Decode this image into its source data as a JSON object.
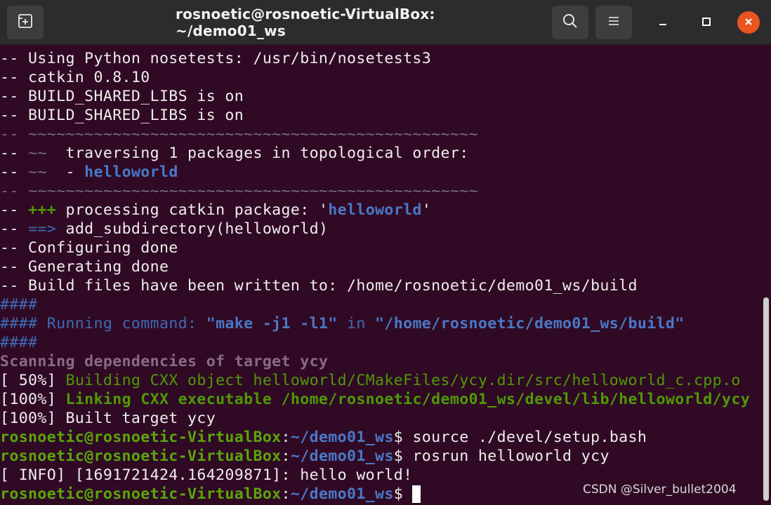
{
  "window": {
    "title": "rosnoetic@rosnoetic-VirtualBox: ~/demo01_ws",
    "new_tab_icon": "new-tab-icon",
    "search_icon": "search-icon",
    "menu_icon": "hamburger-menu-icon",
    "minimize_icon": "minimize-icon",
    "maximize_icon": "maximize-icon",
    "close_icon": "close-icon",
    "close_color": "#e95420",
    "background": "#300a24"
  },
  "terminal": {
    "l1": "-- Using Python nosetests: /usr/bin/nosetests3",
    "l2": "-- catkin 0.8.10",
    "l3": "-- BUILD_SHARED_LIBS is on",
    "l4": "-- BUILD_SHARED_LIBS is on",
    "l5_prefix": "-- ",
    "l5_rule": "~~~~~~~~~~~~~~~~~~~~~~~~~~~~~~~~~~~~~~~~~~~~~~~~",
    "l6_prefix": "-- ",
    "l6_tilde": "~~",
    "l6_text": "  traversing 1 packages in topological order:",
    "l7_prefix": "-- ",
    "l7_tilde": "~~",
    "l7_dash": "  - ",
    "l7_pkg": "helloworld",
    "l8_prefix": "-- ",
    "l8_rule": "~~~~~~~~~~~~~~~~~~~~~~~~~~~~~~~~~~~~~~~~~~~~~~~~",
    "l9_prefix": "-- ",
    "l9_plus": "+++",
    "l9_text": " processing catkin package: '",
    "l9_pkg": "helloworld",
    "l9_end": "'",
    "l10_prefix": "-- ",
    "l10_arrow": "==>",
    "l10_text": " add_subdirectory(helloworld)",
    "l11": "-- Configuring done",
    "l12": "-- Generating done",
    "l13": "-- Build files have been written to: /home/rosnoetic/demo01_ws/build",
    "l14": "####",
    "l15_hash": "####",
    "l15_text": " Running command: ",
    "l15_cmd": "\"make -j1 -l1\"",
    "l15_in": " in ",
    "l15_path": "\"/home/rosnoetic/demo01_ws/build\"",
    "l16": "####",
    "l17": "Scanning dependencies of target ycy",
    "l18_pct": "[ 50%] ",
    "l18_text": "Building CXX object helloworld/CMakeFiles/ycy.dir/src/helloworld_c.cpp.o",
    "l19_pct": "[100%] ",
    "l19_text": "Linking CXX executable /home/rosnoetic/demo01_ws/devel/lib/helloworld/ycy",
    "l20": "[100%] Built target ycy",
    "prompt_user": "rosnoetic@rosnoetic-VirtualBox",
    "prompt_colon": ":",
    "prompt_path": "~/demo01_ws",
    "prompt_dollar": "$ ",
    "cmd1": "source ./devel/setup.bash",
    "cmd2": "rosrun helloworld ycy",
    "l23": "[ INFO] [1691721424.164209871]: hello world!"
  },
  "watermark": "CSDN @Silver_bullet2004"
}
